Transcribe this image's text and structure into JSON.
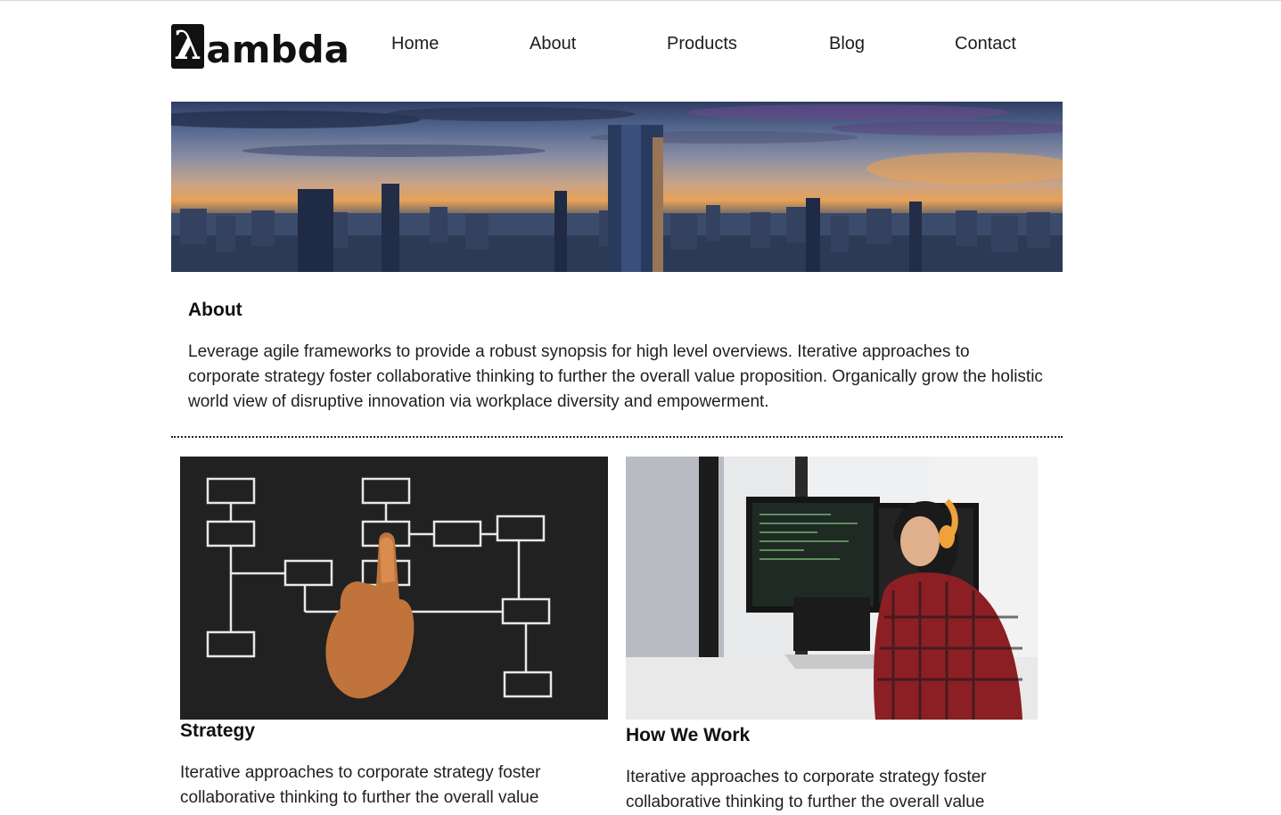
{
  "logo": {
    "glyph": "λ",
    "text": "ambda"
  },
  "nav": {
    "items": [
      "Home",
      "About",
      "Products",
      "Blog",
      "Contact"
    ]
  },
  "hero": {
    "image": "city-skyline-sunset"
  },
  "about": {
    "title": "About",
    "text": "Leverage agile frameworks to provide a robust synopsis for high level overviews. Iterative approaches to corporate strategy foster collaborative thinking to further the overall value proposition. Organically grow the holistic world view of disruptive innovation via workplace diversity and empowerment."
  },
  "cards": [
    {
      "image": "flowchart-hand",
      "title": "Strategy",
      "text": "Iterative approaches to corporate strategy foster collaborative thinking to further the overall value"
    },
    {
      "image": "developer-workstation",
      "title": "How We Work",
      "text": "Iterative approaches to corporate strategy foster collaborative thinking to further the overall value"
    }
  ]
}
